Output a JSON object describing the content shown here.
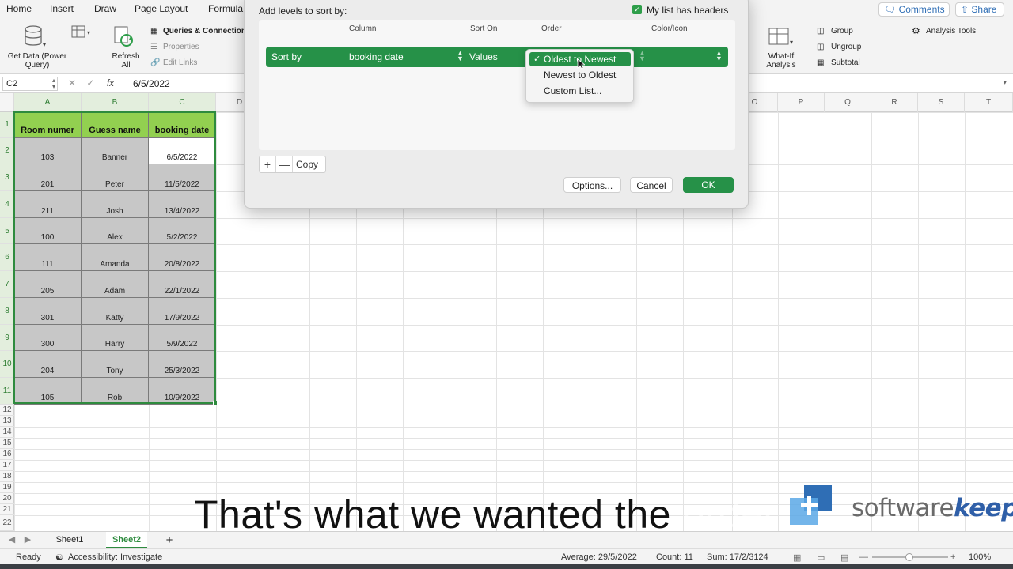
{
  "ribbon_tabs": [
    "Home",
    "Insert",
    "Draw",
    "Page Layout",
    "Formula"
  ],
  "top_buttons": {
    "comments": "Comments",
    "share": "Share"
  },
  "ribbon": {
    "get_data_1": "Get Data (Power",
    "get_data_2": "Query)",
    "refresh_1": "Refresh",
    "refresh_2": "All",
    "queries": "Queries & Connection",
    "properties": "Properties",
    "edit_links": "Edit Links",
    "whatif_1": "What-If",
    "whatif_2": "Analysis",
    "group": "Group",
    "ungroup": "Ungroup",
    "subtotal": "Subtotal",
    "analysis_tools": "Analysis Tools"
  },
  "formula_bar": {
    "name_box": "C2",
    "fx": "fx",
    "value": "6/5/2022"
  },
  "columns": [
    "A",
    "B",
    "C",
    "D",
    "O",
    "P",
    "Q",
    "R",
    "S",
    "T"
  ],
  "rows": [
    "1",
    "2",
    "3",
    "4",
    "5",
    "6",
    "7",
    "8",
    "9",
    "10",
    "11",
    "12",
    "13",
    "14",
    "15",
    "16",
    "17",
    "18",
    "19",
    "20",
    "21",
    "22"
  ],
  "table": {
    "headers": [
      "Room numer",
      "Guess name",
      "booking date"
    ],
    "rows": [
      [
        "103",
        "Banner",
        "6/5/2022"
      ],
      [
        "201",
        "Peter",
        "11/5/2022"
      ],
      [
        "211",
        "Josh",
        "13/4/2022"
      ],
      [
        "100",
        "Alex",
        "5/2/2022"
      ],
      [
        "111",
        "Amanda",
        "20/8/2022"
      ],
      [
        "205",
        "Adam",
        "22/1/2022"
      ],
      [
        "301",
        "Katty",
        "17/9/2022"
      ],
      [
        "300",
        "Harry",
        "5/9/2022"
      ],
      [
        "204",
        "Tony",
        "25/3/2022"
      ],
      [
        "105",
        "Rob",
        "10/9/2022"
      ]
    ]
  },
  "sort_dialog": {
    "title": "Add levels to sort by:",
    "headers_label": "My list has headers",
    "col_headers": [
      "Column",
      "Sort On",
      "Order",
      "Color/Icon"
    ],
    "row": {
      "label": "Sort by",
      "column": "booking date",
      "sort_on": "Values"
    },
    "copy": "Copy",
    "options": "Options...",
    "cancel": "Cancel",
    "ok": "OK",
    "order_options": [
      "Oldest to Newest",
      "Newest to Oldest",
      "Custom List..."
    ]
  },
  "sheets": [
    "Sheet1",
    "Sheet2"
  ],
  "status": {
    "ready": "Ready",
    "accessibility": "Accessibility: Investigate",
    "average": "Average: 29/5/2022",
    "count": "Count: 11",
    "sum": "Sum: 17/2/3124",
    "zoom": "100%"
  },
  "subtitle": {
    "main": "That's what we wanted the",
    "faded": "order"
  },
  "watermark": {
    "plain": "software",
    "bold": "keep"
  },
  "colors": {
    "accent_green": "#269148",
    "header_green": "#92d050",
    "data_gray": "#c7c7c7"
  }
}
